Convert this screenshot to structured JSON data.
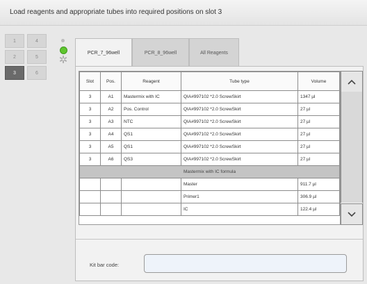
{
  "header": {
    "title": "Load reagents and appropriate tubes into required positions on slot 3"
  },
  "slots": [
    {
      "label": "1",
      "active": false
    },
    {
      "label": "4",
      "active": false
    },
    {
      "label": "2",
      "active": false
    },
    {
      "label": "5",
      "active": false
    },
    {
      "label": "3",
      "active": true
    },
    {
      "label": "6",
      "active": false
    }
  ],
  "tabs": [
    {
      "label": "PCR_7_96well",
      "active": true
    },
    {
      "label": "PCR_8_96well",
      "active": false
    },
    {
      "label": "All Reagents",
      "active": false
    }
  ],
  "table": {
    "columns": [
      "Slot",
      "Pos.",
      "Reagent",
      "Tube type",
      "Volume"
    ],
    "rows": [
      [
        "3",
        "A1",
        "Mastermix with IC",
        "QIA#997102 *2.0 ScrewSkirt",
        "1347 µl"
      ],
      [
        "3",
        "A2",
        "Pos. Control",
        "QIA#997102 *2.0 ScrewSkirt",
        "27 µl"
      ],
      [
        "3",
        "A3",
        "NTC",
        "QIA#997102 *2.0 ScrewSkirt",
        "27 µl"
      ],
      [
        "3",
        "A4",
        "QS1",
        "QIA#997102 *2.0 ScrewSkirt",
        "27 µl"
      ],
      [
        "3",
        "A5",
        "QS1",
        "QIA#997102 *2.0 ScrewSkirt",
        "27 µl"
      ],
      [
        "3",
        "A6",
        "QS3",
        "QIA#997102 *2.0 ScrewSkirt",
        "27 µl"
      ]
    ],
    "group_label": "Mastermix with IC formula",
    "sub_rows": [
      [
        "Master",
        "911.7 µl"
      ],
      [
        "Primer1",
        "306.9 µl"
      ],
      [
        "IC",
        "122.4 µl"
      ]
    ]
  },
  "kit": {
    "label": "Kit bar code:",
    "value": ""
  },
  "icons": {
    "scroll_up": "chevron-up-icon",
    "scroll_down": "chevron-down-icon",
    "cog": "cog-icon"
  },
  "colors": {
    "active_indicator": "#5fc52e",
    "active_slot": "#6a6a6a",
    "input_bg": "#eef3fa"
  }
}
